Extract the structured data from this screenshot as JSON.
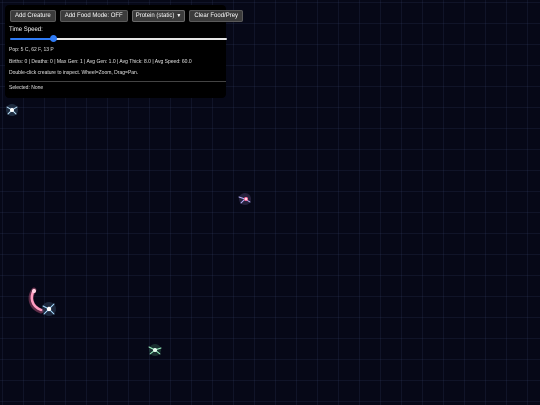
{
  "controls": {
    "add_creature": "Add Creature",
    "add_food_mode": "Add Food Mode: OFF",
    "food_type_selected": "Protein (static)",
    "clear_food": "Clear Food/Prey"
  },
  "speed": {
    "label": "Time Speed:",
    "value_fraction": 0.2
  },
  "stats": {
    "population": "Pop: 5 C, 62 F, 13 P",
    "summary": "Births: 0 | Deaths: 0 | Max Gen: 1 | Avg Gen: 1.0 | Avg Thick: 8.0 | Avg Speed: 60.0",
    "hint": "Double-click creature to inspect. Wheel=Zoom, Drag=Pan.",
    "selected": "Selected: None"
  },
  "colors": {
    "accent": "#2f7bf5",
    "background": "#060817",
    "creature_blue": "#8fd0ff",
    "creature_green": "#7fffb0",
    "creature_purple": "#c9a8ff",
    "creature_pink": "#ff6fa0"
  },
  "creatures": [
    {
      "name": "creature-blue-1",
      "color": "#8fd0ff"
    },
    {
      "name": "creature-purple",
      "color": "#c9a8ff"
    },
    {
      "name": "creature-pink",
      "color": "#ff6fa0"
    },
    {
      "name": "creature-blue-2",
      "color": "#8fd0ff"
    },
    {
      "name": "creature-green",
      "color": "#7fffb0"
    }
  ]
}
